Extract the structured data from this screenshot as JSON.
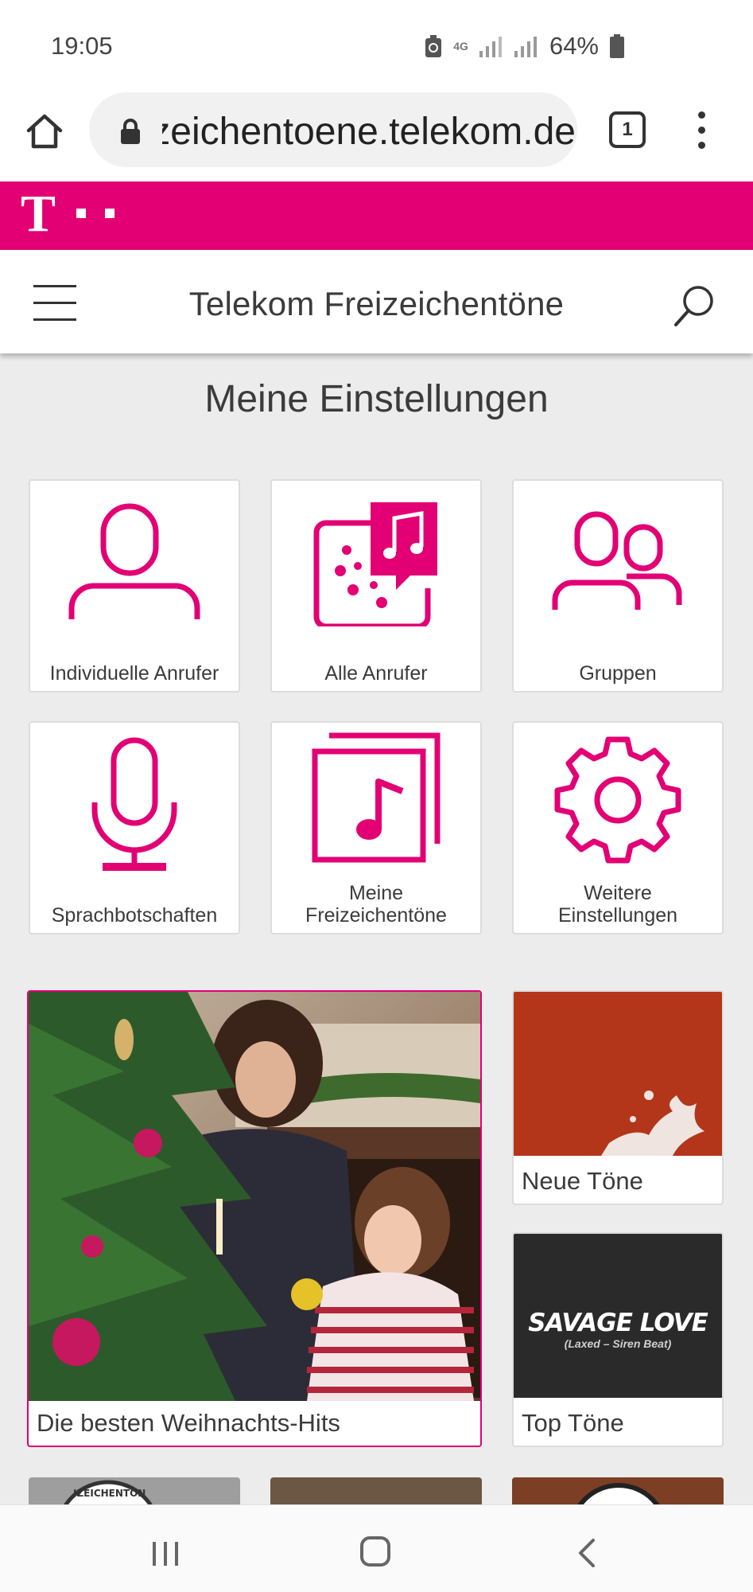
{
  "status_bar": {
    "time": "19:05",
    "network": "4G",
    "battery": "64%"
  },
  "browser": {
    "url": "freizeichentoene.telekom.de",
    "tab_count": "1"
  },
  "brand": {
    "logo_letter": "T",
    "color": "#e20074"
  },
  "header": {
    "title": "Telekom Freizeichentöne"
  },
  "main": {
    "section_title": "Meine Einstellungen",
    "tiles": [
      {
        "label": "Individuelle Anrufer",
        "icon": "person-icon"
      },
      {
        "label": "Alle Anrufer",
        "icon": "music-chat-icon"
      },
      {
        "label": "Gruppen",
        "icon": "group-icon"
      },
      {
        "label": "Sprachbotschaften",
        "icon": "microphone-icon"
      },
      {
        "label": "Meine\nFreizeichentöne",
        "icon": "music-album-icon"
      },
      {
        "label": "Weitere\nEinstellungen",
        "icon": "gear-icon"
      }
    ],
    "promos": [
      {
        "label": "Die besten Weihnachts-Hits",
        "image": "christmas-tree-photo"
      },
      {
        "label": "Neue Töne",
        "image": "red-splash-image"
      },
      {
        "label": "Top Töne",
        "image": "savage-love-cover",
        "cover_title": "SAVAGE LOVE",
        "cover_subtitle": "(Laxed – Siren Beat)"
      }
    ],
    "partial_stamp_text": "IZEICHENTON"
  },
  "accent_color": "#e20074"
}
